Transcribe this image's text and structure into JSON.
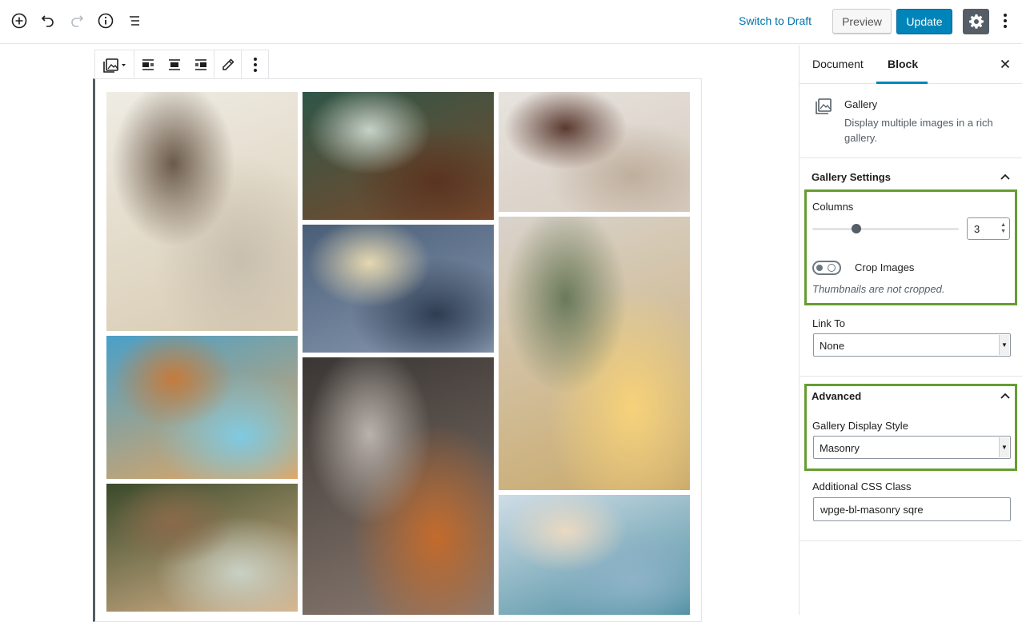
{
  "topbar": {
    "add_icon": "plus-circle-icon",
    "undo_icon": "undo-icon",
    "redo_icon": "redo-icon",
    "info_icon": "info-icon",
    "outline_icon": "list-outline-icon",
    "switch_to_draft": "Switch to Draft",
    "preview": "Preview",
    "update": "Update",
    "settings_icon": "gear-icon",
    "more_icon": "vertical-ellipsis-icon"
  },
  "block_toolbar": {
    "icons": [
      "gallery-icon",
      "align-left-icon",
      "align-center-icon",
      "align-right-icon",
      "edit-icon",
      "more-options-icon"
    ]
  },
  "gallery": {
    "columns": [
      {
        "images": [
          {
            "name": "dining-room",
            "colors": [
              "#efece4",
              "#d8cbb2",
              "#6b5a4a",
              "#c9bfae"
            ]
          },
          {
            "name": "beach-swimmer",
            "colors": [
              "#4aa0c8",
              "#e7a55e",
              "#c57b3c",
              "#7ecae2"
            ]
          },
          {
            "name": "christmas-ornament",
            "colors": [
              "#3a4a2a",
              "#d9b48c",
              "#8a6a4a",
              "#c9d1c4"
            ]
          }
        ]
      },
      {
        "images": [
          {
            "name": "cafe-table",
            "colors": [
              "#2f5648",
              "#7a4a2c",
              "#c7d2c8",
              "#5a3420"
            ]
          },
          {
            "name": "airplane",
            "colors": [
              "#4a5e78",
              "#8899b0",
              "#e6d8b0",
              "#2f3d52"
            ]
          },
          {
            "name": "city-alley",
            "colors": [
              "#3a3634",
              "#8a7a70",
              "#b9b2ab",
              "#c36b2c"
            ]
          }
        ]
      },
      {
        "images": [
          {
            "name": "woman-beach",
            "colors": [
              "#e7e3de",
              "#d6cbbf",
              "#5a3a30",
              "#bfae9c"
            ]
          },
          {
            "name": "gift-candle",
            "colors": [
              "#d9d3cc",
              "#c9a96a",
              "#6a7a5a",
              "#f6d27a"
            ]
          },
          {
            "name": "beach-bicycle",
            "colors": [
              "#cfdde6",
              "#4e8fa2",
              "#ead9c2",
              "#8fb3c8"
            ]
          }
        ]
      }
    ]
  },
  "sidebar": {
    "tab_document": "Document",
    "tab_block": "Block",
    "close_icon": "close-icon",
    "block_icon": "gallery-icon",
    "block_title": "Gallery",
    "block_description": "Display multiple images in a rich gallery.",
    "gallery_settings_title": "Gallery Settings",
    "columns_label": "Columns",
    "columns_value": "3",
    "columns_fraction": 0.3,
    "crop_images_label": "Crop Images",
    "crop_images_on": false,
    "crop_help": "Thumbnails are not cropped.",
    "link_to_label": "Link To",
    "link_to_value": "None",
    "advanced_title": "Advanced",
    "display_style_label": "Gallery Display Style",
    "display_style_value": "Masonry",
    "css_class_label": "Additional CSS Class",
    "css_class_value": "wpge-bl-masonry sqre"
  },
  "colors": {
    "accent": "#0085ba",
    "link": "#0073aa",
    "highlight_box": "#659d32"
  }
}
